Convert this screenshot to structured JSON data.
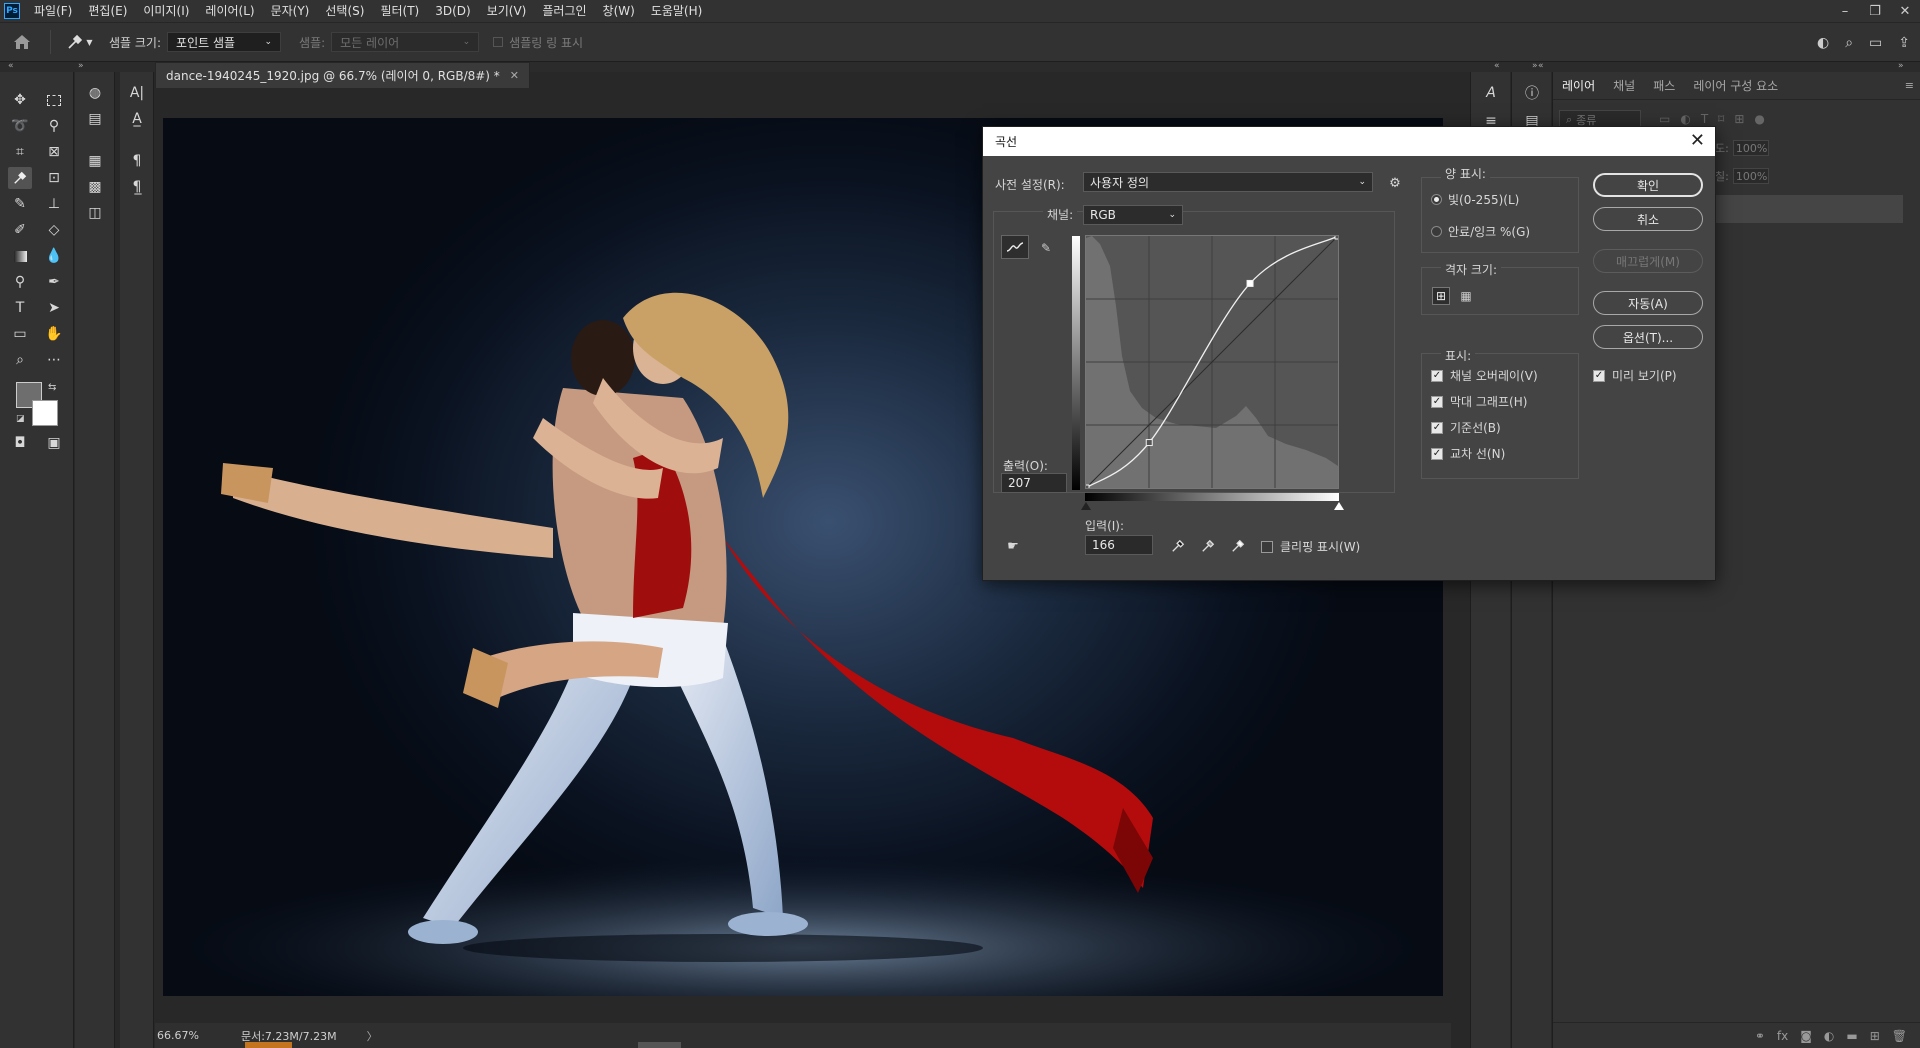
{
  "menubar": {
    "logo": "Ps",
    "items": [
      "파일(F)",
      "편집(E)",
      "이미지(I)",
      "레이어(L)",
      "문자(Y)",
      "선택(S)",
      "필터(T)",
      "3D(D)",
      "보기(V)",
      "플러그인",
      "창(W)",
      "도움말(H)"
    ]
  },
  "options": {
    "sample_size_label": "샘플 크기:",
    "sample_size_value": "포인트 샘플",
    "sample_label": "샘플:",
    "sample_value": "모든 레이어",
    "show_ring_label": "샘플링 링 표시"
  },
  "document": {
    "tab_title": "dance-1940245_1920.jpg @ 66.7% (레이어 0, RGB/8#) *",
    "zoom": "66.67%",
    "doc_info": "문서:7.23M/7.23M"
  },
  "layers_panel": {
    "tabs": [
      "레이어",
      "채널",
      "패스",
      "레이어 구성 요소"
    ],
    "search_placeholder": "종류",
    "opacity_label": "도:",
    "opacity_value": "100%",
    "fill_label": "칠:",
    "fill_value": "100%"
  },
  "curves": {
    "title": "곡선",
    "preset_label": "사전 설정(R):",
    "preset_value": "사용자 정의",
    "channel_label": "채널:",
    "channel_value": "RGB",
    "output_label": "출력(O):",
    "output_value": "207",
    "input_label": "입력(I):",
    "input_value": "166",
    "clipping_label": "클리핑 표시(W)",
    "display_amount_label": "양 표시:",
    "radio_light": "빛(0-255)(L)",
    "radio_pigment": "안료/잉크 %(G)",
    "grid_size_label": "격자 크기:",
    "show_label": "표시:",
    "check_overlay": "채널 오버레이(V)",
    "check_histogram": "막대 그래프(H)",
    "check_baseline": "기준선(B)",
    "check_intersection": "교차 선(N)",
    "btn_ok": "확인",
    "btn_cancel": "취소",
    "btn_smooth": "매끄럽게(M)",
    "btn_auto": "자동(A)",
    "btn_options": "옵션(T)...",
    "preview_label": "미리 보기(P)",
    "curve_points": [
      [
        0,
        0
      ],
      [
        64,
        46
      ],
      [
        166,
        207
      ],
      [
        255,
        255
      ]
    ]
  }
}
